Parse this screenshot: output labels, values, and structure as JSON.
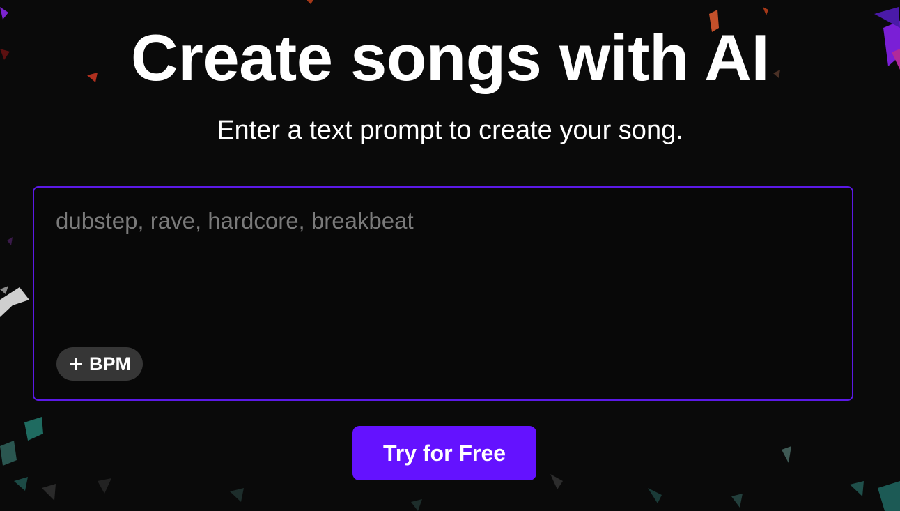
{
  "hero": {
    "title": "Create songs with AI",
    "subtitle": "Enter a text prompt to create your song."
  },
  "prompt": {
    "value": "",
    "placeholder": "dubstep, rave, hardcore, breakbeat"
  },
  "bpm_chip": {
    "icon": "plus-icon",
    "label": "BPM"
  },
  "cta": {
    "label": "Try for Free"
  },
  "colors": {
    "background": "#0a0a0a",
    "accent": "#6412ff",
    "box_border": "#5b19e6",
    "chip_bg": "#363636",
    "placeholder": "#7a7a7a"
  }
}
